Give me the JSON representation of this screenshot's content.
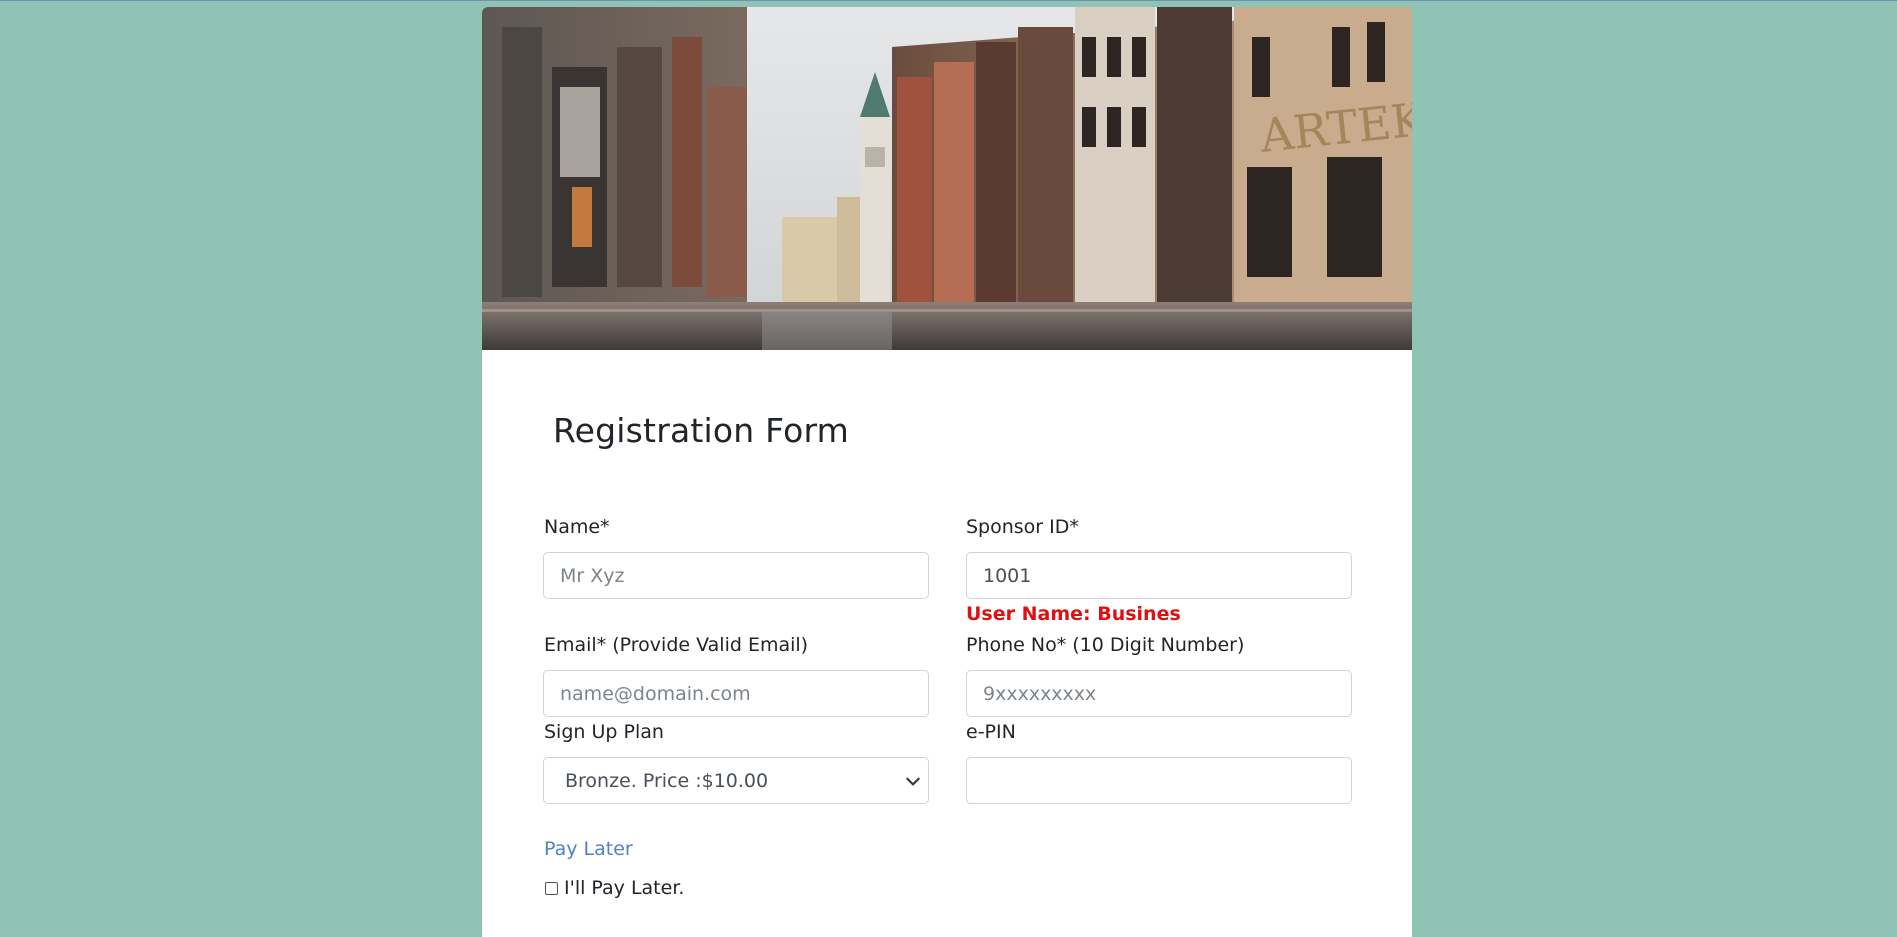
{
  "form": {
    "title": "Registration Form",
    "name_label": "Name*",
    "name_placeholder": "Mr Xyz",
    "sponsor_label": "Sponsor ID*",
    "sponsor_value": "1001",
    "sponsor_status": "User Name: Busines",
    "email_label": "Email* (Provide Valid Email)",
    "email_placeholder": "name@domain.com",
    "phone_label": "Phone No* (10 Digit Number)",
    "phone_placeholder": "9xxxxxxxxx",
    "plan_label": "Sign Up Plan",
    "plan_selected": "Bronze. Price :$10.00",
    "epin_label": "e-PIN",
    "epin_value": "",
    "pay_later_link": "Pay Later",
    "pay_later_checkbox_label": "I'll Pay Later.",
    "pay_later_checked": false
  },
  "hero": {
    "sign_text": "ARTEKA Ce"
  },
  "colors": {
    "background": "#8fc4b4",
    "error": "#dd1111",
    "link": "#4f82c4"
  }
}
